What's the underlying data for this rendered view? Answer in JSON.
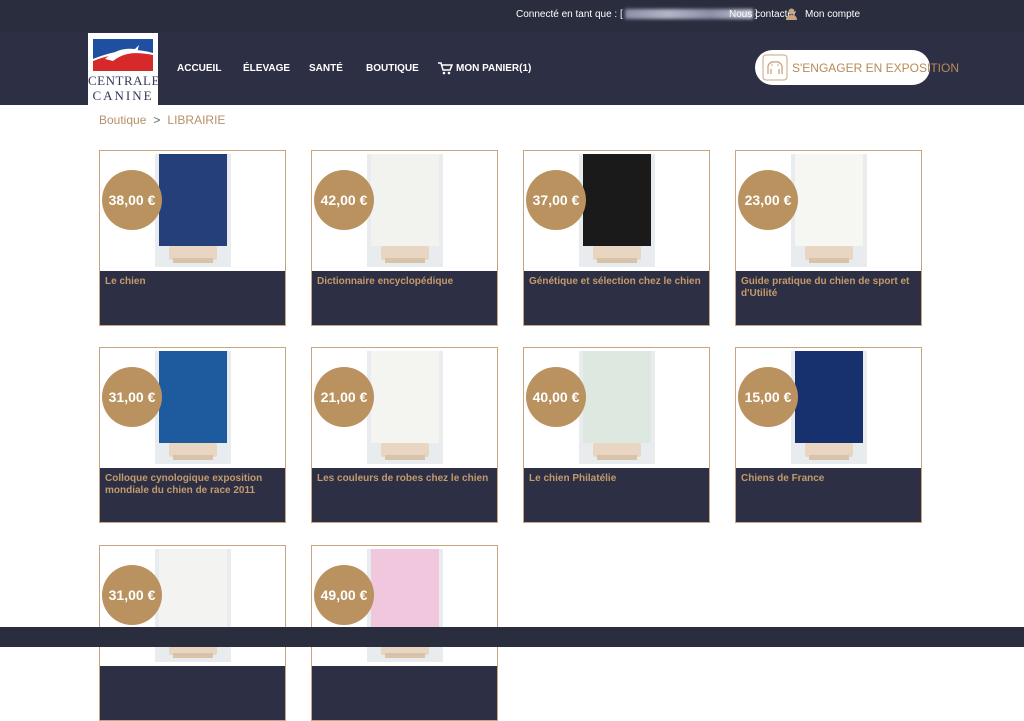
{
  "topbar": {
    "connected_label": "Connecté en tant que : [",
    "connected_suffix": "]",
    "contact": "Nous contacter",
    "account": "Mon compte"
  },
  "logo": {
    "line1": "CENTRALE",
    "line2": "CANINE"
  },
  "nav": {
    "items": [
      "ACCUEIL",
      "ÉLEVAGE",
      "SANTÉ",
      "BOUTIQUE",
      "MON PANIER(1)"
    ],
    "cta": "S'ENGAGER EN EXPOSITION"
  },
  "breadcrumb": {
    "root": "Boutique",
    "separator": ">",
    "current": "LIBRAIRIE"
  },
  "products": [
    {
      "price": "38,00 €",
      "title": "Le chien",
      "cover_color": "#243f7a"
    },
    {
      "price": "42,00 €",
      "title": "Dictionnaire encyclopédique",
      "cover_color": "#f2f2ee"
    },
    {
      "price": "37,00 €",
      "title": "Génétique et sélection chez le chien",
      "cover_color": "#1a1a1a"
    },
    {
      "price": "23,00 €",
      "title": "Guide pratique du chien de sport et d'Utilité",
      "cover_color": "#f6f6f2"
    },
    {
      "price": "31,00 €",
      "title": "Colloque cynologique exposition mondiale du chien de race 2011",
      "cover_color": "#1d5a9e"
    },
    {
      "price": "21,00 €",
      "title": "Les couleurs de robes chez le chien",
      "cover_color": "#f4f4f0"
    },
    {
      "price": "40,00 €",
      "title": "Le chien Philatélie",
      "cover_color": "#dde8e0"
    },
    {
      "price": "15,00 €",
      "title": "Chiens de France",
      "cover_color": "#17306e"
    },
    {
      "price": "31,00 €",
      "title": "",
      "cover_color": "#f3f3f1"
    },
    {
      "price": "49,00 €",
      "title": "",
      "cover_color": "#f0c7dc"
    }
  ],
  "colors": {
    "navy": "#2d3044",
    "gold": "#b9925f",
    "gold_text": "#c49a6c"
  }
}
